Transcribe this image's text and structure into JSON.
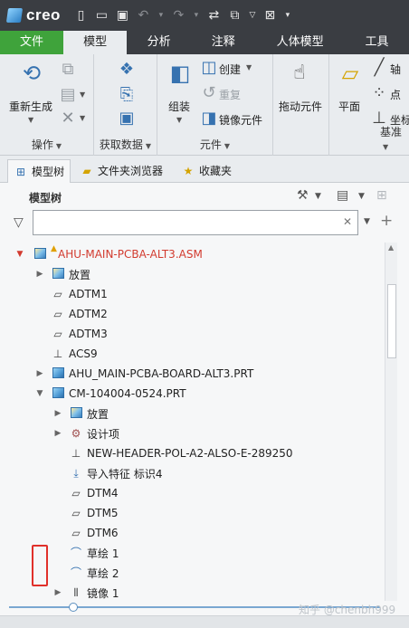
{
  "app": {
    "name": "creo"
  },
  "ribbon_tabs": [
    {
      "label": "文件"
    },
    {
      "label": "模型"
    },
    {
      "label": "分析"
    },
    {
      "label": "注释"
    },
    {
      "label": "人体模型"
    },
    {
      "label": "工具"
    }
  ],
  "ribbon": {
    "operations": {
      "regenerate": "重新生成",
      "group": "操作"
    },
    "get_data": {
      "group": "获取数据"
    },
    "components": {
      "assemble": "组装",
      "create": "创建",
      "repeat": "重复",
      "mirror": "镜像元件",
      "drag": "拖动元件",
      "group": "元件"
    },
    "datum": {
      "plane": "平面",
      "axis": "轴",
      "point": "点",
      "csys": "坐标",
      "group": "基准"
    }
  },
  "panel_tabs": [
    {
      "label": "模型树"
    },
    {
      "label": "文件夹浏览器"
    },
    {
      "label": "收藏夹"
    }
  ],
  "model_tree": {
    "title": "模型树",
    "search_value": "",
    "items": [
      {
        "label": "AHU-MAIN-PCBA-ALT3.ASM"
      },
      {
        "label": "放置"
      },
      {
        "label": "ADTM1"
      },
      {
        "label": "ADTM2"
      },
      {
        "label": "ADTM3"
      },
      {
        "label": "ACS9"
      },
      {
        "label": "AHU_MAIN-PCBA-BOARD-ALT3.PRT"
      },
      {
        "label": "CM-104004-0524.PRT"
      },
      {
        "label": "放置"
      },
      {
        "label": "设计项"
      },
      {
        "label": "NEW-HEADER-POL-A2-ALSO-E-289250"
      },
      {
        "label": "导入特征 标识4"
      },
      {
        "label": "DTM4"
      },
      {
        "label": "DTM5"
      },
      {
        "label": "DTM6"
      },
      {
        "label": "草绘 1"
      },
      {
        "label": "草绘 2"
      },
      {
        "label": "镜像 1"
      }
    ]
  },
  "watermark": "知乎 @chenbh999",
  "colors": {
    "file_tab": "#3fa33b",
    "titlebar": "#3a3d42",
    "root_text": "#d23b2f",
    "highlight_box": "#e0302a"
  }
}
